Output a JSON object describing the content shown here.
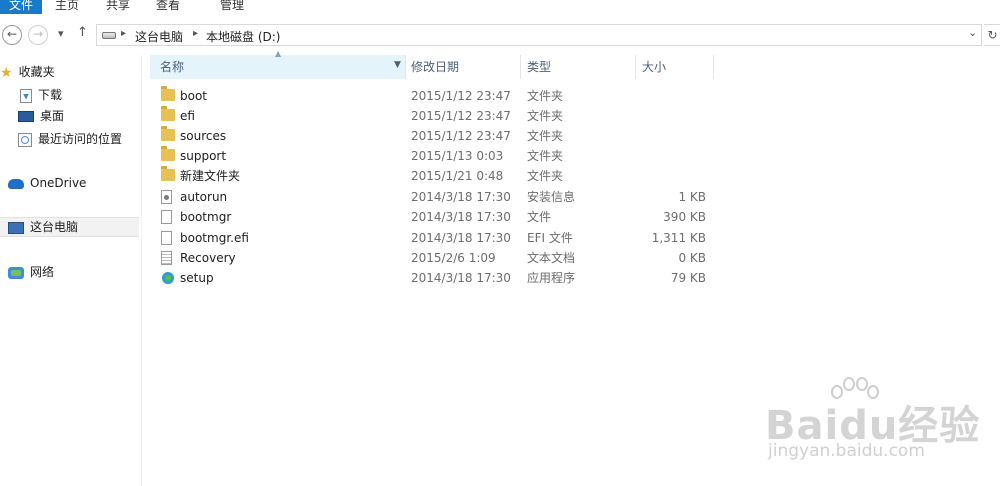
{
  "ribbon": {
    "tabs": [
      {
        "label": "文件",
        "active": true
      },
      {
        "label": "主页",
        "active": false
      },
      {
        "label": "共享",
        "active": false
      },
      {
        "label": "查看",
        "active": false
      },
      {
        "label": "管理",
        "active": false
      }
    ]
  },
  "address": {
    "back_glyph": "←",
    "forward_glyph": "→",
    "recent_glyph": "▾",
    "up_glyph": "↑",
    "breadcrumbs": [
      "这台电脑",
      "本地磁盘 (D:)"
    ],
    "separator": "▸",
    "dropdown_glyph": "⌄",
    "refresh_glyph": "↻"
  },
  "nav": {
    "favorites": "收藏夹",
    "downloads": "下载",
    "desktop": "桌面",
    "recent": "最近访问的位置",
    "onedrive": "OneDrive",
    "thispc": "这台电脑",
    "network": "网络"
  },
  "columns": {
    "name": "名称",
    "modified": "修改日期",
    "type": "类型",
    "size": "大小"
  },
  "files": [
    {
      "name": "boot",
      "date": "2015/1/12 23:47",
      "type": "文件夹",
      "size": "",
      "icon": "folder-icon"
    },
    {
      "name": "efi",
      "date": "2015/1/12 23:47",
      "type": "文件夹",
      "size": "",
      "icon": "folder-icon"
    },
    {
      "name": "sources",
      "date": "2015/1/12 23:47",
      "type": "文件夹",
      "size": "",
      "icon": "folder-icon"
    },
    {
      "name": "support",
      "date": "2015/1/13 0:03",
      "type": "文件夹",
      "size": "",
      "icon": "folder-icon"
    },
    {
      "name": "新建文件夹",
      "date": "2015/1/21 0:48",
      "type": "文件夹",
      "size": "",
      "icon": "folder-icon"
    },
    {
      "name": "autorun",
      "date": "2014/3/18 17:30",
      "type": "安装信息",
      "size": "1 KB",
      "icon": "setup-info-icon"
    },
    {
      "name": "bootmgr",
      "date": "2014/3/18 17:30",
      "type": "文件",
      "size": "390 KB",
      "icon": "file-icon"
    },
    {
      "name": "bootmgr.efi",
      "date": "2014/3/18 17:30",
      "type": "EFI 文件",
      "size": "1,311 KB",
      "icon": "file-icon"
    },
    {
      "name": "Recovery",
      "date": "2015/2/6 1:09",
      "type": "文本文档",
      "size": "0 KB",
      "icon": "text-file-icon"
    },
    {
      "name": "setup",
      "date": "2014/3/18 17:30",
      "type": "应用程序",
      "size": "79 KB",
      "icon": "setup-app-icon"
    }
  ],
  "watermark": {
    "main": "Baidu经验",
    "sub": "jingyan.baidu.com"
  }
}
